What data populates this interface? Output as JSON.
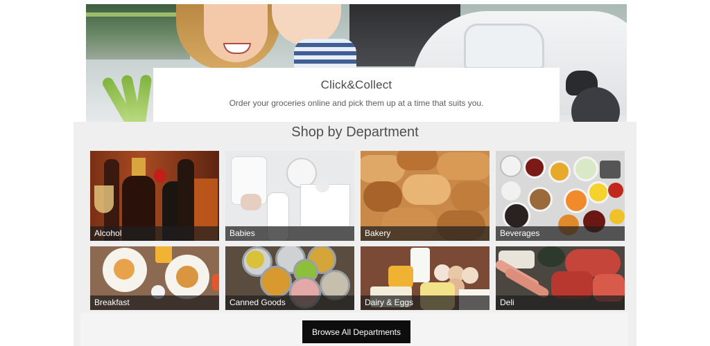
{
  "promo": {
    "title": "Click&Collect",
    "subtitle": "Order your groceries online and pick them up at a time that suits you."
  },
  "department_section": {
    "title": "Shop by Department",
    "tiles": [
      {
        "label": "Alcohol",
        "icon": "alcohol-bottles-image"
      },
      {
        "label": "Babies",
        "icon": "baby-bottle-image"
      },
      {
        "label": "Bakery",
        "icon": "bread-rolls-image"
      },
      {
        "label": "Beverages",
        "icon": "juice-glasses-image"
      },
      {
        "label": "Breakfast",
        "icon": "pancakes-plate-image"
      },
      {
        "label": "Canned Goods",
        "icon": "open-cans-image"
      },
      {
        "label": "Dairy & Eggs",
        "icon": "eggs-cheese-milk-image"
      },
      {
        "label": "Deli",
        "icon": "cured-meats-image"
      }
    ]
  },
  "browse_button": {
    "label": "Browse All Departments"
  },
  "colors": {
    "button_bg": "#0d0d0d",
    "section_bg": "#efefef",
    "label_overlay": "rgba(30,30,30,0.72)"
  }
}
